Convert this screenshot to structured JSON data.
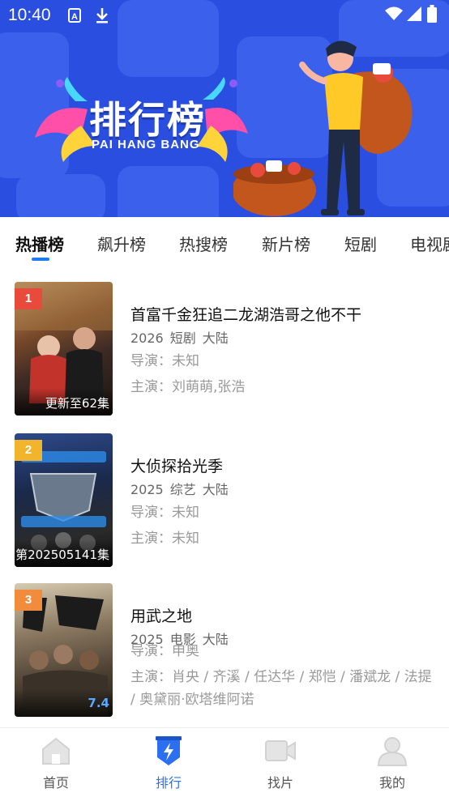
{
  "status_bar": {
    "time": "10:40"
  },
  "banner": {
    "title": "排行榜",
    "subtitle": "PAI HANG BANG"
  },
  "tabs": [
    {
      "label": "热播榜",
      "active": true
    },
    {
      "label": "飙升榜",
      "active": false
    },
    {
      "label": "热搜榜",
      "active": false
    },
    {
      "label": "新片榜",
      "active": false
    },
    {
      "label": "短剧",
      "active": false
    },
    {
      "label": "电视剧",
      "active": false
    }
  ],
  "items": [
    {
      "rank": "1",
      "rank_color": "#e84b3c",
      "caption": "更新至62集",
      "title": "首富千金狂追二龙湖浩哥之他不干",
      "year": "2026",
      "genre": "短剧",
      "region": "大陆",
      "director": "导演：未知",
      "cast": "主演：刘萌萌,张浩"
    },
    {
      "rank": "2",
      "rank_color": "#f2b42a",
      "caption": "第202505141集",
      "title": "大侦探拾光季",
      "year": "2025",
      "genre": "综艺",
      "region": "大陆",
      "director": "导演：未知",
      "cast": "主演：未知"
    },
    {
      "rank": "3",
      "rank_color": "#f08c3c",
      "caption": "7.4",
      "title": "用武之地",
      "year": "2025",
      "genre": "电影",
      "region": "大陆",
      "director": "导演：申奥",
      "cast": "主演：肖央 / 齐溪 / 任达华 / 郑恺 / 潘斌龙 / 法提 / 奥黛丽·欧塔维阿诺"
    }
  ],
  "bottom_nav": [
    {
      "label": "首页",
      "icon": "home-icon",
      "active": false
    },
    {
      "label": "排行",
      "icon": "ranking-shield-icon",
      "active": true
    },
    {
      "label": "找片",
      "icon": "video-camera-icon",
      "active": false
    },
    {
      "label": "我的",
      "icon": "user-profile-icon",
      "active": false
    }
  ],
  "colors": {
    "banner": "#2a4ee0",
    "accent": "#2c6ff0",
    "tab_indicator": "#1e7bf0"
  }
}
